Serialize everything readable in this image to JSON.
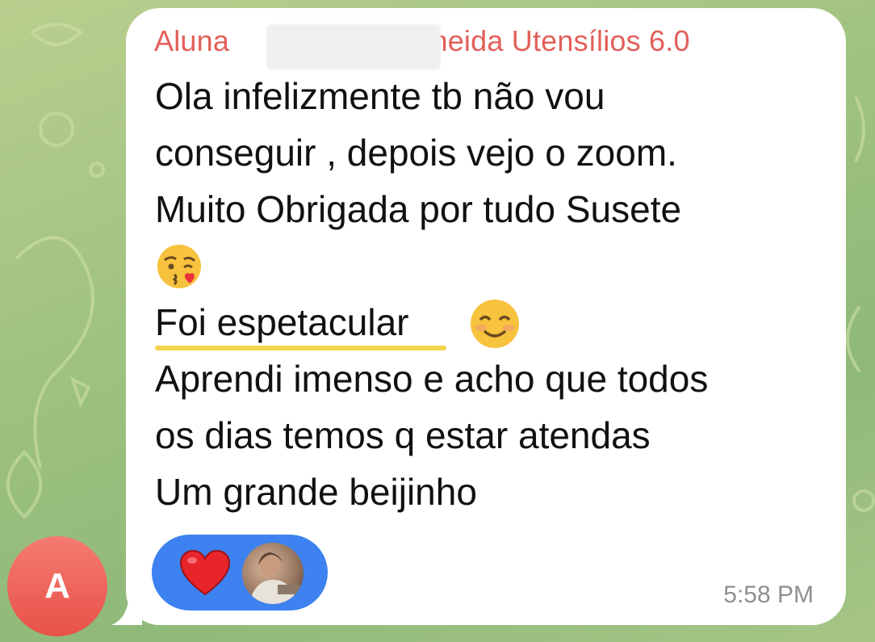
{
  "message": {
    "sender": "Aluna — — — neida Utensílios 6.0",
    "sender_prefix": "Aluna",
    "sender_suffix": "neida Utensílios 6.0",
    "lines": [
      "Ola infelizmente tb não vou",
      "conseguir , depois vejo o zoom.",
      "Muito Obrigada por tudo Susete",
      "Foi espetacular",
      "Aprendi imenso e acho que todos",
      "os dias temos q estar atendas",
      "Um grande beijinho"
    ],
    "time": "5:58 PM"
  },
  "avatar": {
    "initial": "A"
  },
  "reactions": {
    "items": [
      "heart-icon"
    ]
  },
  "colors": {
    "sender": "#e2605a",
    "highlight": "#f1d44a",
    "reaction_bg": "#3d82f0",
    "avatar_bg": "#e85249"
  }
}
